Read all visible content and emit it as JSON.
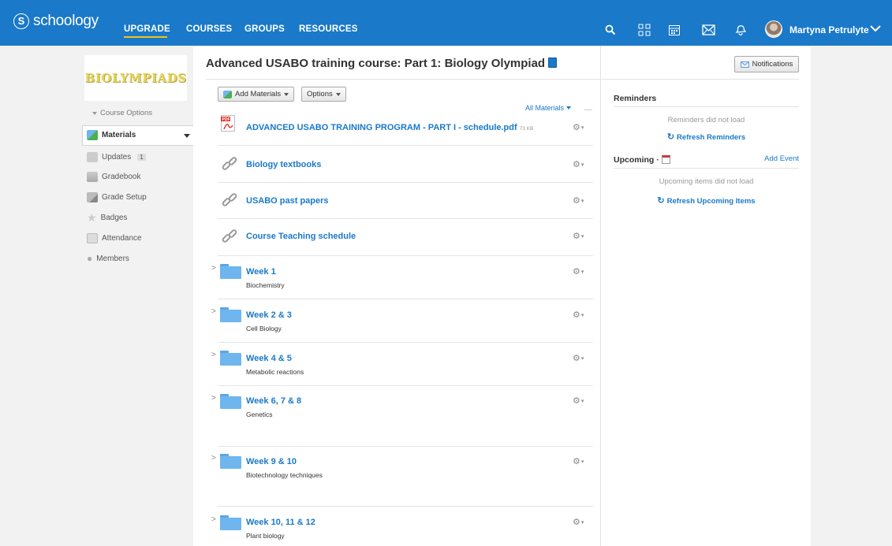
{
  "nav": {
    "brand_symbol": "S",
    "brand": "schoology",
    "links": {
      "upgrade": "UPGRADE",
      "courses": "COURSES",
      "groups": "GROUPS",
      "resources": "RESOURCES"
    },
    "user": "Martyna Petrulyte",
    "icons": [
      "search-icon",
      "grid-icon",
      "calendar-icon",
      "mail-icon",
      "bell-icon"
    ]
  },
  "page": {
    "title": "Advanced USABO training course: Part 1: Biology Olympiad",
    "notifications_label": "Notifications"
  },
  "toolbar": {
    "add_materials": "Add Materials",
    "options": "Options",
    "all_materials": "All Materials"
  },
  "materials": [
    {
      "type": "pdf",
      "title": "ADVANCED USABO TRAINING PROGRAM - PART I - schedule.pdf",
      "size": "73 KB"
    },
    {
      "type": "link",
      "title": "Biology textbooks"
    },
    {
      "type": "link",
      "title": "USABO past papers"
    },
    {
      "type": "link",
      "title": "Course Teaching schedule"
    },
    {
      "type": "folder",
      "title": "Week 1",
      "subtitle": "Biochemistry"
    },
    {
      "type": "folder",
      "title": "Week 2 & 3",
      "subtitle": "Cell Biology"
    },
    {
      "type": "folder",
      "title": "Week 4 & 5",
      "subtitle": "Metabolic reactions"
    },
    {
      "type": "folder",
      "title": "Week 6, 7 & 8",
      "subtitle": "Genetics"
    },
    {
      "type": "folder",
      "title": "Week 9 & 10",
      "subtitle": "Biotechnology techniques"
    },
    {
      "type": "folder",
      "title": "Week 10, 11 & 12",
      "subtitle": "Plant biology"
    }
  ],
  "reminders": {
    "heading": "Reminders",
    "message": "Reminders did not load",
    "refresh": "Refresh Reminders"
  },
  "upcoming": {
    "heading": "Upcoming",
    "separator": "·",
    "add_event": "Add Event",
    "message": "Upcoming items did not load",
    "refresh": "Refresh Upcoming Items"
  },
  "sidebar": {
    "logo_text": "BIOLYMPIADS",
    "course_options": "Course Options",
    "items": [
      {
        "label": "Materials",
        "active": true
      },
      {
        "label": "Updates",
        "badge": "1"
      },
      {
        "label": "Gradebook"
      },
      {
        "label": "Grade Setup"
      },
      {
        "label": "Badges"
      },
      {
        "label": "Attendance"
      },
      {
        "label": "Members"
      }
    ]
  },
  "colors": {
    "nav_blue": "#1a79c8",
    "link_blue": "#1a79c8",
    "nav_underline": "#f0c419",
    "folder_blue": "#6fb6ee"
  }
}
